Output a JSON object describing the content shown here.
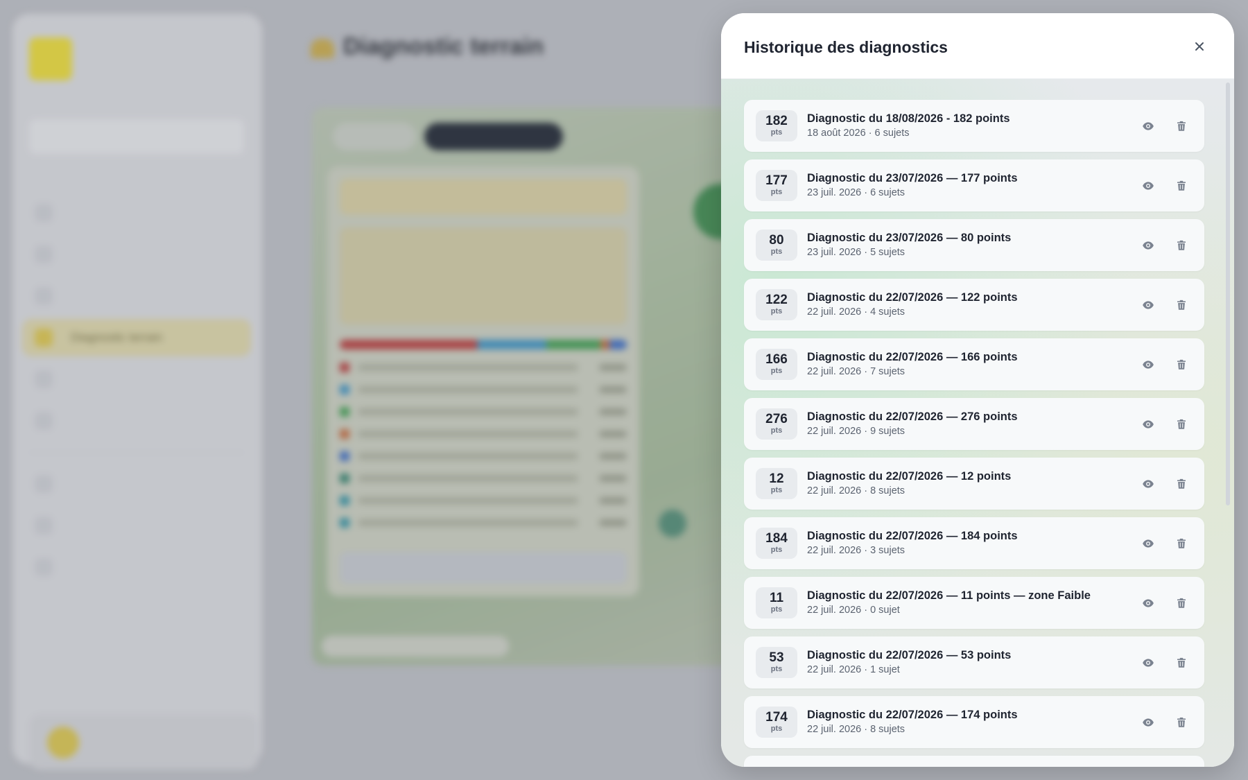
{
  "background": {
    "logo_text": "",
    "sidebar_section": "",
    "select_value": "",
    "page_title": "Diagnostic terrain",
    "page_subtitle": "",
    "nav_items": [
      {
        "label": "",
        "active": false
      },
      {
        "label": "",
        "active": false
      },
      {
        "label": "",
        "active": false
      },
      {
        "label": "Diagnostic terrain",
        "active": true
      },
      {
        "label": "",
        "active": false
      },
      {
        "label": "",
        "active": false
      }
    ],
    "nav_items_secondary": [
      {
        "label": ""
      },
      {
        "label": ""
      },
      {
        "label": ""
      }
    ],
    "map_tabs": [
      {
        "label": ""
      },
      {
        "label": ""
      }
    ],
    "legend_rows": 8
  },
  "modal": {
    "title": "Historique des diagnostics",
    "unit": "pts",
    "items": [
      {
        "points": "182",
        "title": "Diagnostic du 18/08/2026 - 182 points",
        "meta": "18 août 2026 · 6 sujets"
      },
      {
        "points": "177",
        "title": "Diagnostic du 23/07/2026 — 177 points",
        "meta": "23 juil. 2026 · 6 sujets"
      },
      {
        "points": "80",
        "title": "Diagnostic du 23/07/2026 — 80 points",
        "meta": "23 juil. 2026 · 5 sujets"
      },
      {
        "points": "122",
        "title": "Diagnostic du 22/07/2026 — 122 points",
        "meta": "22 juil. 2026 · 4 sujets"
      },
      {
        "points": "166",
        "title": "Diagnostic du 22/07/2026 — 166 points",
        "meta": "22 juil. 2026 · 7 sujets"
      },
      {
        "points": "276",
        "title": "Diagnostic du 22/07/2026 — 276 points",
        "meta": "22 juil. 2026 · 9 sujets"
      },
      {
        "points": "12",
        "title": "Diagnostic du 22/07/2026 — 12 points",
        "meta": "22 juil. 2026 · 8 sujets"
      },
      {
        "points": "184",
        "title": "Diagnostic du 22/07/2026 — 184 points",
        "meta": "22 juil. 2026 · 3 sujets"
      },
      {
        "points": "11",
        "title": "Diagnostic du 22/07/2026 — 11 points — zone Faible",
        "meta": "22 juil. 2026 · 0 sujet"
      },
      {
        "points": "53",
        "title": "Diagnostic du 22/07/2026 — 53 points",
        "meta": "22 juil. 2026 · 1 sujet"
      },
      {
        "points": "174",
        "title": "Diagnostic du 22/07/2026 — 174 points",
        "meta": "22 juil. 2026 · 8 sujets"
      }
    ]
  },
  "colors": {
    "accent_yellow": "#e7d838",
    "text_primary": "#1f2430",
    "text_secondary": "#5b6370",
    "icon_gray": "#6b7280"
  },
  "icons": {
    "close": "close-icon",
    "view": "eye-icon",
    "delete": "trash-icon"
  }
}
